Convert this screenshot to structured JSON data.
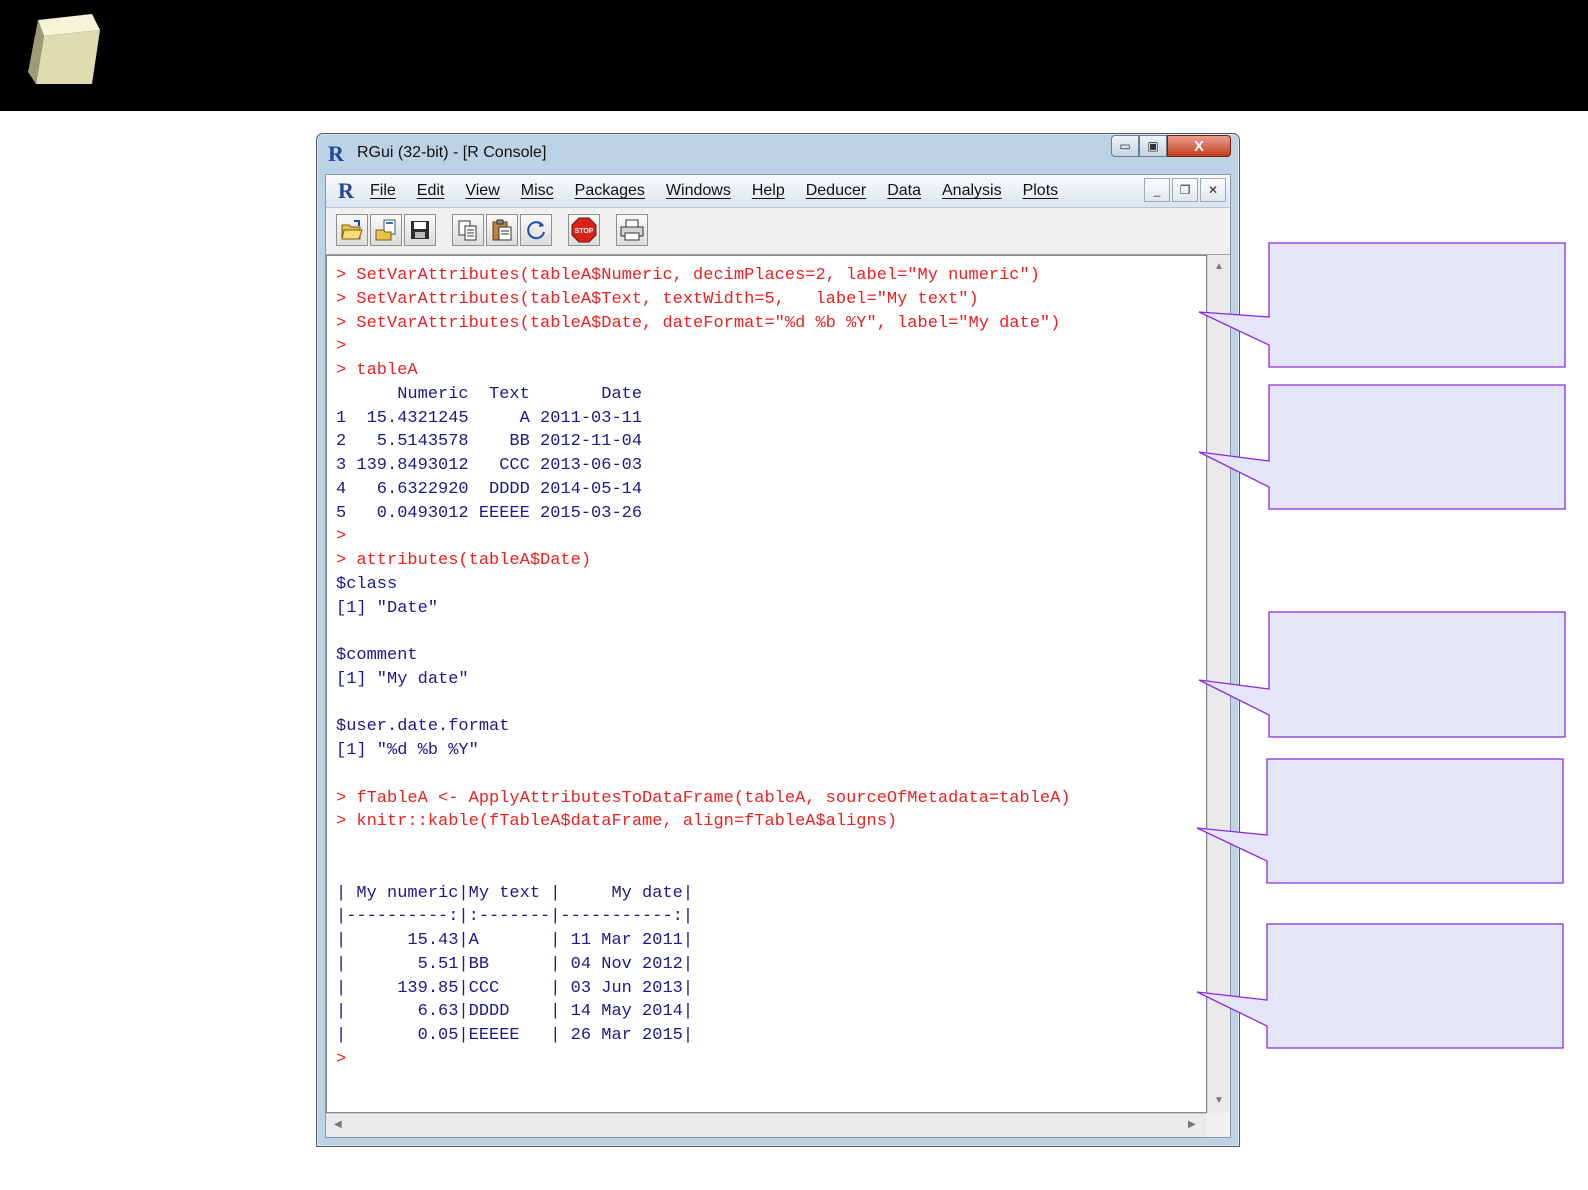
{
  "window": {
    "title": "RGui (32-bit) - [R Console]",
    "logo_letter": "R",
    "min_glyph": "▭",
    "max_glyph": "▣",
    "close_glyph": "X"
  },
  "menu": {
    "items": [
      "File",
      "Edit",
      "View",
      "Misc",
      "Packages",
      "Windows",
      "Help",
      "Deducer",
      "Data",
      "Analysis",
      "Plots"
    ],
    "mdi_min": "_",
    "mdi_restore": "❐",
    "mdi_close": "✕"
  },
  "toolbar": {
    "buttons": [
      {
        "icon": "open-script-icon"
      },
      {
        "icon": "load-workspace-icon"
      },
      {
        "icon": "save-icon"
      },
      {
        "icon": "copy-icon"
      },
      {
        "icon": "paste-icon"
      },
      {
        "icon": "copy-paste-icon"
      },
      {
        "icon": "stop-icon",
        "text": "STOP"
      },
      {
        "icon": "print-icon"
      }
    ]
  },
  "console": {
    "lines": [
      {
        "t": "> SetVarAttributes(tableA$Numeric, decimPlaces=2, label=\"My numeric\")",
        "k": "cmd"
      },
      {
        "t": "> SetVarAttributes(tableA$Text, textWidth=5,   label=\"My text\")",
        "k": "cmd"
      },
      {
        "t": "> SetVarAttributes(tableA$Date, dateFormat=\"%d %b %Y\", label=\"My date\")",
        "k": "cmd"
      },
      {
        "t": ">",
        "k": "cmd"
      },
      {
        "t": "> tableA",
        "k": "cmd"
      },
      {
        "t": "      Numeric  Text       Date",
        "k": "out"
      },
      {
        "t": "1  15.4321245     A 2011-03-11",
        "k": "out"
      },
      {
        "t": "2   5.5143578    BB 2012-11-04",
        "k": "out"
      },
      {
        "t": "3 139.8493012   CCC 2013-06-03",
        "k": "out"
      },
      {
        "t": "4   6.6322920  DDDD 2014-05-14",
        "k": "out"
      },
      {
        "t": "5   0.0493012 EEEEE 2015-03-26",
        "k": "out"
      },
      {
        "t": ">",
        "k": "cmd"
      },
      {
        "t": "> attributes(tableA$Date)",
        "k": "cmd"
      },
      {
        "t": "$class",
        "k": "out"
      },
      {
        "t": "[1] \"Date\"",
        "k": "out"
      },
      {
        "t": "",
        "k": "out"
      },
      {
        "t": "$comment",
        "k": "out"
      },
      {
        "t": "[1] \"My date\"",
        "k": "out"
      },
      {
        "t": "",
        "k": "out"
      },
      {
        "t": "$user.date.format",
        "k": "out"
      },
      {
        "t": "[1] \"%d %b %Y\"",
        "k": "out"
      },
      {
        "t": "",
        "k": "out"
      },
      {
        "t": "> fTableA <- ApplyAttributesToDataFrame(tableA, sourceOfMetadata=tableA)",
        "k": "cmd"
      },
      {
        "t": "> knitr::kable(fTableA$dataFrame, align=fTableA$aligns)",
        "k": "cmd"
      },
      {
        "t": "",
        "k": "out"
      },
      {
        "t": "",
        "k": "out"
      },
      {
        "t": "| My numeric|My text |     My date|",
        "k": "out"
      },
      {
        "t": "|----------:|:-------|-----------:|",
        "k": "out"
      },
      {
        "t": "|      15.43|A       | 11 Mar 2011|",
        "k": "out"
      },
      {
        "t": "|       5.51|BB      | 04 Nov 2012|",
        "k": "out"
      },
      {
        "t": "|     139.85|CCC     | 03 Jun 2013|",
        "k": "out"
      },
      {
        "t": "|       6.63|DDDD    | 14 May 2014|",
        "k": "out"
      },
      {
        "t": "|       0.05|EEEEE   | 26 Mar 2015|",
        "k": "out"
      },
      {
        "t": ">",
        "k": "cmd"
      }
    ]
  },
  "scrollbar": {
    "up": "▲",
    "down": "▼",
    "left": "◀",
    "right": "▶"
  },
  "colors": {
    "command": "#ee1f1f",
    "output": "#1a1a8c",
    "callout_fill": "#e6e6fa",
    "callout_stroke": "#8a2be2"
  }
}
